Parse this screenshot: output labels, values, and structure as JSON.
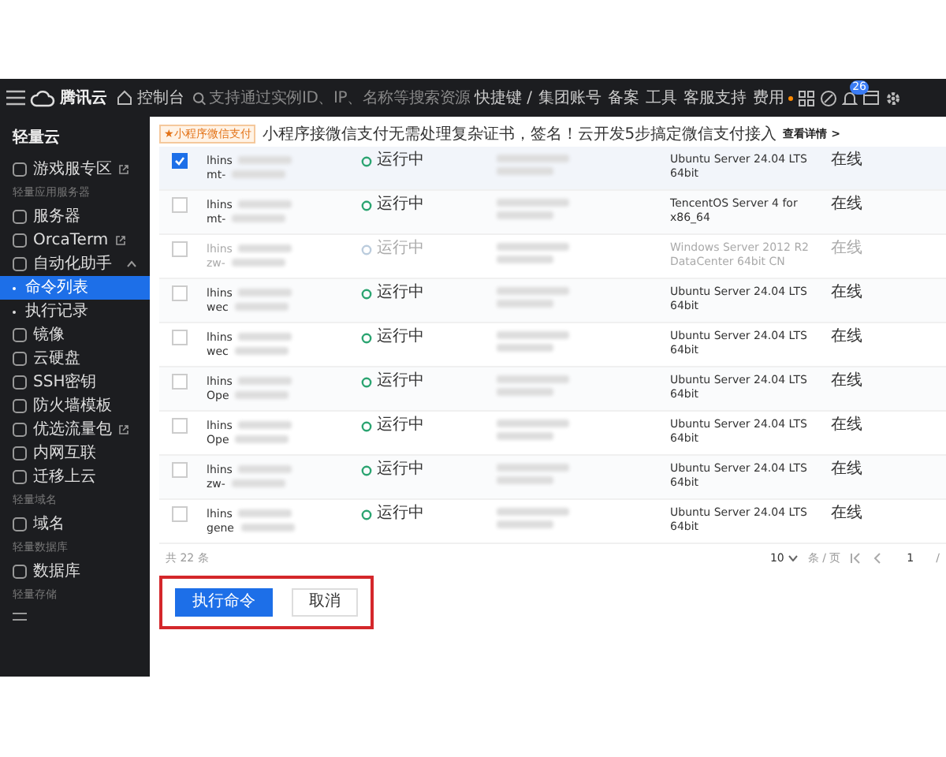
{
  "topbar": {
    "logo": "腾讯云",
    "console": "控制台",
    "search": {
      "placeholder": "支持通过实例ID、IP、名称等搜索资源"
    },
    "shortcut": "快捷键 /",
    "nav": [
      {
        "label": "集团账号",
        "dot": false
      },
      {
        "label": "备案",
        "dot": false
      },
      {
        "label": "工具",
        "dot": false
      },
      {
        "label": "客服支持",
        "dot": false
      },
      {
        "label": "费用",
        "dot": true
      }
    ],
    "badge": "26"
  },
  "sidebar": {
    "title": "轻量云",
    "items": [
      {
        "kind": "item",
        "label": "游戏服专区",
        "external": true,
        "selected": false
      },
      {
        "kind": "section",
        "label": "轻量应用服务器"
      },
      {
        "kind": "item",
        "label": "服务器",
        "external": false,
        "selected": false
      },
      {
        "kind": "item",
        "label": "OrcaTerm",
        "external": true,
        "selected": false
      },
      {
        "kind": "group",
        "label": "自动化助手",
        "external": false,
        "selected": false,
        "expanded": true
      },
      {
        "kind": "sub",
        "label": "命令列表",
        "selected": true
      },
      {
        "kind": "sub",
        "label": "执行记录",
        "selected": false
      },
      {
        "kind": "item",
        "label": "镜像",
        "external": false,
        "selected": false
      },
      {
        "kind": "item",
        "label": "云硬盘",
        "external": false,
        "selected": false
      },
      {
        "kind": "item",
        "label": "SSH密钥",
        "external": false,
        "selected": false
      },
      {
        "kind": "item",
        "label": "防火墙模板",
        "external": false,
        "selected": false
      },
      {
        "kind": "item",
        "label": "优选流量包",
        "external": true,
        "selected": false
      },
      {
        "kind": "item",
        "label": "内网互联",
        "external": false,
        "selected": false
      },
      {
        "kind": "item",
        "label": "迁移上云",
        "external": false,
        "selected": false
      },
      {
        "kind": "section",
        "label": "轻量域名"
      },
      {
        "kind": "item",
        "label": "域名",
        "external": false,
        "selected": false
      },
      {
        "kind": "section",
        "label": "轻量数据库"
      },
      {
        "kind": "item",
        "label": "数据库",
        "external": false,
        "selected": false
      },
      {
        "kind": "section",
        "label": "轻量存储"
      }
    ]
  },
  "banner": {
    "tag": "★小程序微信支付",
    "text": "小程序接微信支付无需处理复杂证书，签名！云开发5步搞定微信支付接入",
    "link": "查看详情 >"
  },
  "table": {
    "rows": [
      {
        "name_1": "lhins",
        "name_2": "mt-",
        "status": "运行中",
        "os": "Ubuntu Server 24.04 LTS 64bit",
        "state": "在线",
        "checked": true,
        "disabled": false
      },
      {
        "name_1": "lhins",
        "name_2": "mt-",
        "status": "运行中",
        "os": "TencentOS Server 4 for x86_64",
        "state": "在线",
        "checked": false,
        "disabled": false
      },
      {
        "name_1": "lhins",
        "name_2": "zw-",
        "status": "运行中",
        "os": "Windows Server 2012 R2 DataCenter 64bit CN",
        "state": "在线",
        "checked": false,
        "disabled": true
      },
      {
        "name_1": "lhins",
        "name_2": "wec",
        "status": "运行中",
        "os": "Ubuntu Server 24.04 LTS 64bit",
        "state": "在线",
        "checked": false,
        "disabled": false
      },
      {
        "name_1": "lhins",
        "name_2": "wec",
        "status": "运行中",
        "os": "Ubuntu Server 24.04 LTS 64bit",
        "state": "在线",
        "checked": false,
        "disabled": false
      },
      {
        "name_1": "lhins",
        "name_2": "Ope",
        "status": "运行中",
        "os": "Ubuntu Server 24.04 LTS 64bit",
        "state": "在线",
        "checked": false,
        "disabled": false
      },
      {
        "name_1": "lhins",
        "name_2": "Ope",
        "status": "运行中",
        "os": "Ubuntu Server 24.04 LTS 64bit",
        "state": "在线",
        "checked": false,
        "disabled": false
      },
      {
        "name_1": "lhins",
        "name_2": "zw-",
        "status": "运行中",
        "os": "Ubuntu Server 24.04 LTS 64bit",
        "state": "在线",
        "checked": false,
        "disabled": false
      },
      {
        "name_1": "lhins",
        "name_2": "gene",
        "status": "运行中",
        "os": "Ubuntu Server 24.04 LTS 64bit",
        "state": "在线",
        "checked": false,
        "disabled": false
      }
    ]
  },
  "footer": {
    "total": "共 22 条",
    "page_size": "10",
    "per_page": "条 / 页",
    "page": "1",
    "page_sep": "/"
  },
  "actions": {
    "highlighted": true,
    "buttons": [
      {
        "kind": "primary",
        "label": "执行命令"
      },
      {
        "kind": "secondary",
        "label": "取消"
      }
    ]
  }
}
